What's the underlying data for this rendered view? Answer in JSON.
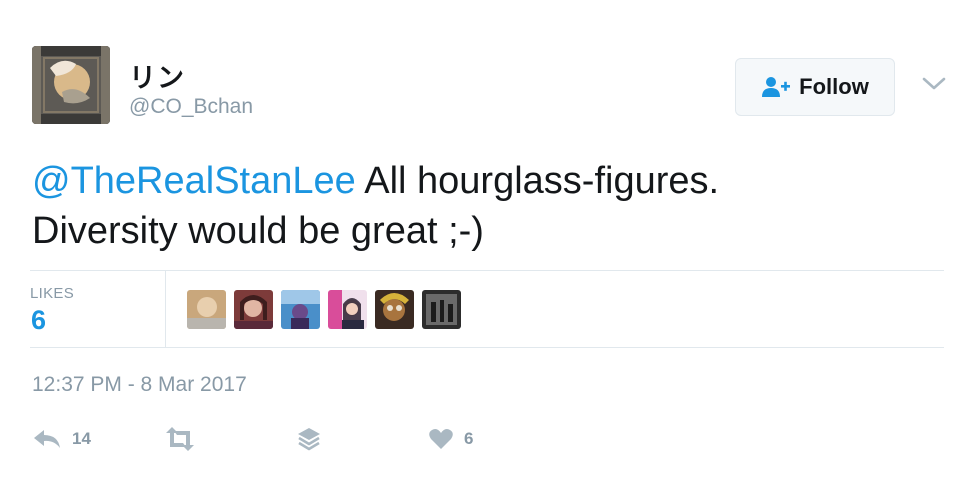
{
  "user": {
    "display_name": "リン",
    "handle": "@CO_Bchan"
  },
  "follow": {
    "label": "Follow"
  },
  "tweet": {
    "mention": "@TheRealStanLee",
    "text_line1_rest": " All hourglass-figures.",
    "text_line2": "Diversity would be great ;-)"
  },
  "stats": {
    "likes_label": "LIKES",
    "likes_count": "6"
  },
  "timestamp": "12:37 PM - 8 Mar 2017",
  "actions": {
    "reply_count": "14",
    "like_count": "6"
  },
  "colors": {
    "link": "#1b95e0",
    "muted": "#8899a6",
    "text": "#14171a",
    "border": "#e1e8ed"
  },
  "icons": {
    "follow": "person-plus-icon",
    "menu": "chevron-down-icon",
    "reply": "reply-icon",
    "retweet": "retweet-icon",
    "stack": "layers-icon",
    "like": "heart-icon"
  }
}
